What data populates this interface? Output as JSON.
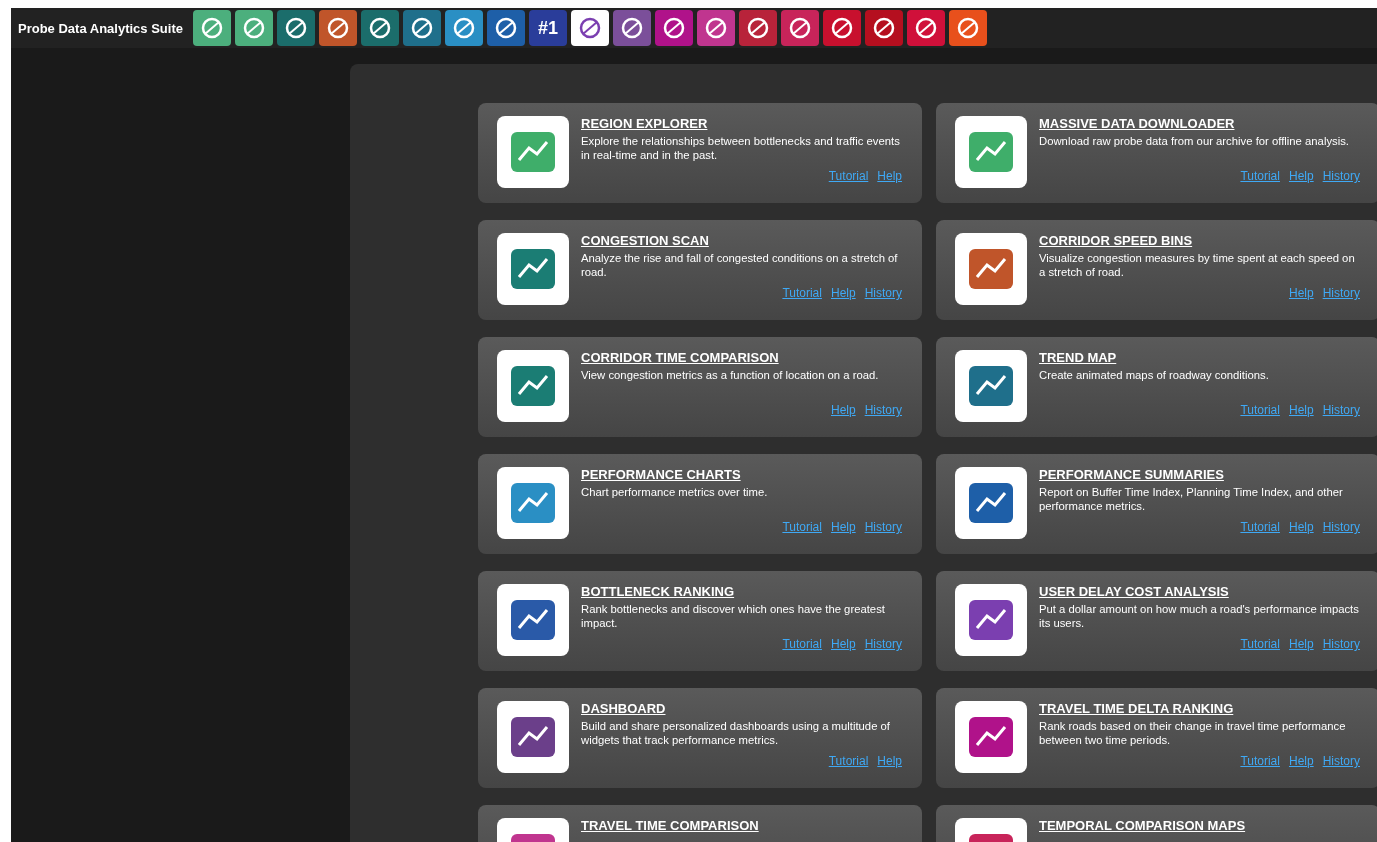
{
  "app_title": "Probe Data Analytics Suite",
  "toolbar": [
    {
      "color": "#4caf7d"
    },
    {
      "color": "#4caf7d"
    },
    {
      "color": "#1b6d6b"
    },
    {
      "color": "#c0552a"
    },
    {
      "color": "#1b6d6b"
    },
    {
      "color": "#1f6f8b"
    },
    {
      "color": "#2a8fc4"
    },
    {
      "color": "#1e5fa8"
    },
    {
      "color": "#2a3d9a",
      "label": "#1"
    },
    {
      "color": "#ffffff"
    },
    {
      "color": "#7b4f9a"
    },
    {
      "color": "#b0128a"
    },
    {
      "color": "#c0358f"
    },
    {
      "color": "#b8233a"
    },
    {
      "color": "#c8245a"
    },
    {
      "color": "#c8102e"
    },
    {
      "color": "#b50f1f"
    },
    {
      "color": "#d0103a"
    },
    {
      "color": "#e8501c"
    }
  ],
  "tools": [
    {
      "title": "REGION EXPLORER",
      "description": "Explore the relationships between bottlenecks and traffic events in real-time and in the past.",
      "links": [
        "Tutorial",
        "Help"
      ]
    },
    {
      "title": "MASSIVE DATA DOWNLOADER",
      "description": "Download raw probe data from our archive for offline analysis.",
      "links": [
        "Tutorial",
        "Help",
        "History"
      ]
    },
    {
      "title": "CONGESTION SCAN",
      "description": "Analyze the rise and fall of congested conditions on a stretch of road.",
      "links": [
        "Tutorial",
        "Help",
        "History"
      ]
    },
    {
      "title": "CORRIDOR SPEED BINS",
      "description": "Visualize congestion measures by time spent at each speed on a stretch of road.",
      "links": [
        "Help",
        "History"
      ]
    },
    {
      "title": "CORRIDOR TIME COMPARISON",
      "description": "View congestion metrics as a function of location on a road.",
      "links": [
        "Help",
        "History"
      ]
    },
    {
      "title": "TREND MAP",
      "description": "Create animated maps of roadway conditions.",
      "links": [
        "Tutorial",
        "Help",
        "History"
      ]
    },
    {
      "title": "PERFORMANCE CHARTS",
      "description": "Chart performance metrics over time.",
      "links": [
        "Tutorial",
        "Help",
        "History"
      ]
    },
    {
      "title": "PERFORMANCE SUMMARIES",
      "description": "Report on Buffer Time Index, Planning Time Index, and other performance metrics.",
      "links": [
        "Tutorial",
        "Help",
        "History"
      ]
    },
    {
      "title": "BOTTLENECK RANKING",
      "description": "Rank bottlenecks and discover which ones have the greatest impact.",
      "links": [
        "Tutorial",
        "Help",
        "History"
      ]
    },
    {
      "title": "USER DELAY COST ANALYSIS",
      "description": "Put a dollar amount on how much a road's performance impacts its users.",
      "links": [
        "Tutorial",
        "Help",
        "History"
      ]
    },
    {
      "title": "DASHBOARD",
      "description": "Build and share personalized dashboards using a multitude of widgets that track performance metrics.",
      "links": [
        "Tutorial",
        "Help"
      ]
    },
    {
      "title": "TRAVEL TIME DELTA RANKING",
      "description": "Rank roads based on their change in travel time performance between two time periods.",
      "links": [
        "Tutorial",
        "Help",
        "History"
      ]
    },
    {
      "title": "TRAVEL TIME COMPARISON"
    },
    {
      "title": "TEMPORAL COMPARISON MAPS"
    }
  ]
}
